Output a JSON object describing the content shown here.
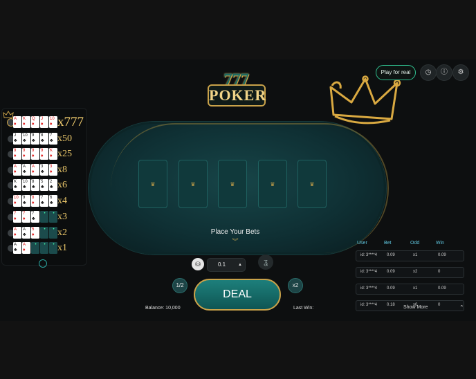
{
  "logo": {
    "top": "777",
    "bottom": "POKER"
  },
  "header": {
    "play_for_real": "Play for real"
  },
  "icons": {
    "history": "history-icon",
    "info": "info-icon",
    "settings": "gear-icon",
    "crown": "crown-icon"
  },
  "table": {
    "prompt": "Place Your Bets"
  },
  "paytable": {
    "rows": [
      {
        "multiplier": "x777",
        "cards": [
          [
            "A",
            "red"
          ],
          [
            "K",
            "red"
          ],
          [
            "Q",
            "red"
          ],
          [
            "J",
            "red"
          ],
          [
            "10",
            "red"
          ]
        ]
      },
      {
        "multiplier": "x50",
        "cards": [
          [
            "J",
            "black"
          ],
          [
            "10",
            "black"
          ],
          [
            "9",
            "black"
          ],
          [
            "8",
            "black"
          ],
          [
            "7",
            "black"
          ]
        ]
      },
      {
        "multiplier": "x25",
        "cards": [
          [
            "9",
            "red"
          ],
          [
            "9",
            "red"
          ],
          [
            "9",
            "red"
          ],
          [
            "9",
            "red"
          ],
          [
            "K",
            "red"
          ]
        ]
      },
      {
        "multiplier": "x8",
        "cards": [
          [
            "A",
            "red"
          ],
          [
            "A",
            "black"
          ],
          [
            "A",
            "red"
          ],
          [
            "3",
            "black"
          ],
          [
            "3",
            "red"
          ]
        ]
      },
      {
        "multiplier": "x6",
        "cards": [
          [
            "K",
            "black"
          ],
          [
            "10",
            "black"
          ],
          [
            "8",
            "black"
          ],
          [
            "5",
            "black"
          ],
          [
            "2",
            "black"
          ]
        ]
      },
      {
        "multiplier": "x4",
        "cards": [
          [
            "10",
            "red"
          ],
          [
            "9",
            "black"
          ],
          [
            "8",
            "red"
          ],
          [
            "7",
            "black"
          ],
          [
            "6",
            "black"
          ]
        ]
      },
      {
        "multiplier": "x3",
        "cards": [
          [
            "7",
            "red"
          ],
          [
            "7",
            "red"
          ],
          [
            "7",
            "black"
          ],
          [
            "",
            ""
          ],
          [
            "",
            ""
          ]
        ]
      },
      {
        "multiplier": "x2",
        "cards": [
          [
            "A",
            "red"
          ],
          [
            "A",
            "black"
          ],
          [
            "5",
            "red"
          ],
          [
            "",
            ""
          ],
          [
            "",
            ""
          ]
        ]
      },
      {
        "multiplier": "x1",
        "cards": [
          [
            "A",
            "black"
          ],
          [
            "A",
            "red"
          ],
          [
            "",
            ""
          ],
          [
            "",
            ""
          ],
          [
            "",
            ""
          ]
        ]
      }
    ]
  },
  "controls": {
    "bet_value": "0.1",
    "half": "1/2",
    "double": "x2",
    "deal": "DEAL",
    "balance": "Balance: 10,000",
    "last_win": "Last Win:"
  },
  "bets_table": {
    "headers": [
      "User",
      "Bet",
      "Odd",
      "Win"
    ],
    "rows": [
      [
        "id: 3****4",
        "0.09",
        "x1",
        "0.09"
      ],
      [
        "id: 3****4",
        "0.09",
        "x2",
        "0"
      ],
      [
        "id: 3****4",
        "0.09",
        "x1",
        "0.09"
      ],
      [
        "id: 3****4",
        "0.18",
        "x0",
        "0"
      ]
    ],
    "show_more": "Show More"
  },
  "colors": {
    "gold": "#c9a24a",
    "felt": "#0f3034",
    "accent": "#2fbf8f"
  }
}
